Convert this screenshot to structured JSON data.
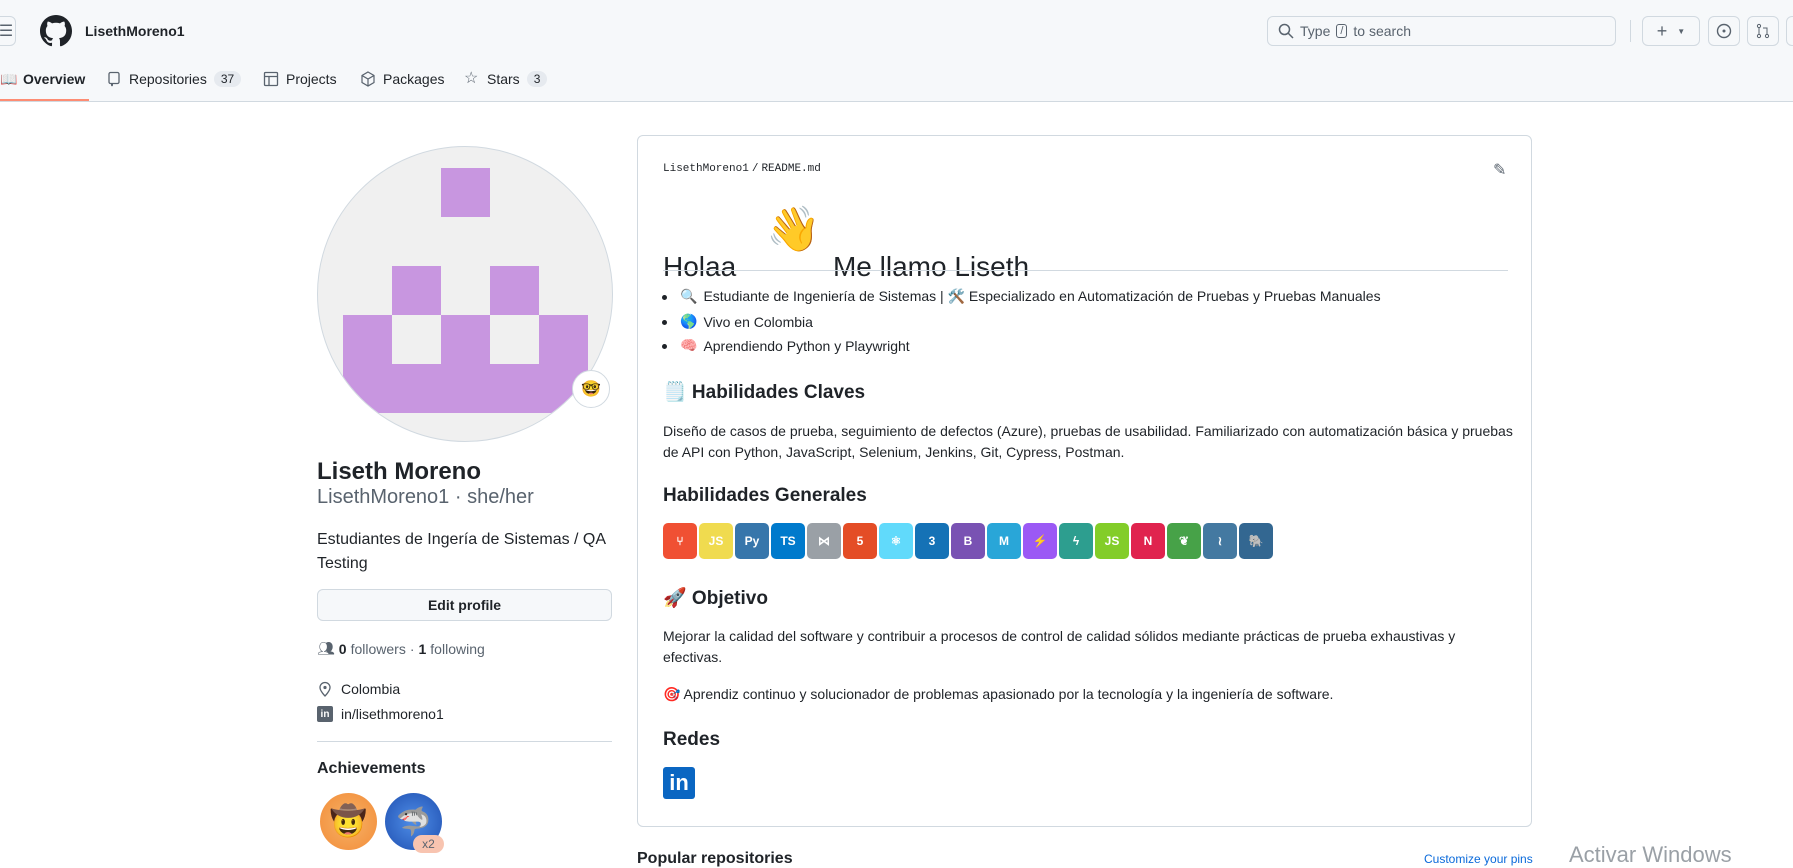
{
  "header": {
    "username": "LisethMoreno1",
    "search_placeholder_pre": "Type",
    "search_key": "/",
    "search_placeholder_post": "to search",
    "new_label": "+"
  },
  "tabs": [
    {
      "label": "Overview",
      "active": true
    },
    {
      "label": "Repositories",
      "count": "37"
    },
    {
      "label": "Projects"
    },
    {
      "label": "Packages"
    },
    {
      "label": "Stars",
      "count": "3"
    }
  ],
  "profile": {
    "name": "Liseth Moreno",
    "login_pronouns": "LisethMoreno1 · she/her",
    "bio": "Estudiantes de Ingería de Sistemas / QA Testing",
    "edit_label": "Edit profile",
    "followers": "0",
    "followers_label": "followers",
    "sep": "·",
    "following": "1",
    "following_label": "following",
    "location": "Colombia",
    "linkedin": "in/lisethmoreno1",
    "achievements_title": "Achievements",
    "achievement_multiplier": "x2",
    "identicon_color": "#c896e0"
  },
  "readme": {
    "owner": "LisethMoreno1",
    "file": "README.md",
    "title_a": "Holaa",
    "title_b": "Me llamo Liseth",
    "bullets": [
      {
        "emoji": "🔍",
        "text": "Estudiante de Ingeniería de Sistemas | 🛠️ Especializado en Automatización de Pruebas y Pruebas Manuales"
      },
      {
        "emoji": "🌎",
        "text": "Vivo en Colombia"
      },
      {
        "emoji": "🧠",
        "text": "Aprendiendo Python y Playwright"
      }
    ],
    "h_claves": "🗒️ Habilidades Claves",
    "p_claves": "Diseño de casos de prueba, seguimiento de defectos (Azure), pruebas de usabilidad. Familiarizado con automatización básica y pruebas de API con Python, JavaScript, Selenium, Jenkins, Git, Cypress, Postman.",
    "h_generales": "Habilidades Generales",
    "skills": [
      {
        "name": "git",
        "label": "⑂",
        "color": "#f05033"
      },
      {
        "name": "javascript",
        "label": "JS",
        "color": "#f0db4f"
      },
      {
        "name": "python",
        "label": "Py",
        "color": "#3776ab"
      },
      {
        "name": "typescript",
        "label": "TS",
        "color": "#007acc"
      },
      {
        "name": "visual-studio",
        "label": "⋈",
        "color": "#9aa0a6"
      },
      {
        "name": "html5",
        "label": "5",
        "color": "#e44d26"
      },
      {
        "name": "react",
        "label": "⚛",
        "color": "#61dafb"
      },
      {
        "name": "css3",
        "label": "3",
        "color": "#1572b6"
      },
      {
        "name": "bootstrap",
        "label": "B",
        "color": "#7952b3"
      },
      {
        "name": "mui",
        "label": "M",
        "color": "#29a6d8"
      },
      {
        "name": "vite",
        "label": "⚡",
        "color": "#9b59f5"
      },
      {
        "name": "fastapi",
        "label": "ϟ",
        "color": "#2d9e8f"
      },
      {
        "name": "nodejs",
        "label": "JS",
        "color": "#83cd29"
      },
      {
        "name": "nestjs",
        "label": "N",
        "color": "#e0234e"
      },
      {
        "name": "mongodb",
        "label": "❦",
        "color": "#47a248"
      },
      {
        "name": "mysql",
        "label": "≀",
        "color": "#4479a1"
      },
      {
        "name": "postgresql",
        "label": "🐘",
        "color": "#336791"
      }
    ],
    "h_objetivo": "🚀 Objetivo",
    "p_objetivo": "Mejorar la calidad del software y contribuir a procesos de control de calidad sólidos mediante prácticas de prueba exhaustivas y efectivas.",
    "p_aprendiz": "🎯 Aprendiz continuo y solucionador de problemas apasionado por la tecnología y la ingeniería de software.",
    "h_redes": "Redes"
  },
  "footer": {
    "popular": "Popular repositories",
    "customize": "Customize your pins",
    "watermark": "Activar Windows"
  }
}
